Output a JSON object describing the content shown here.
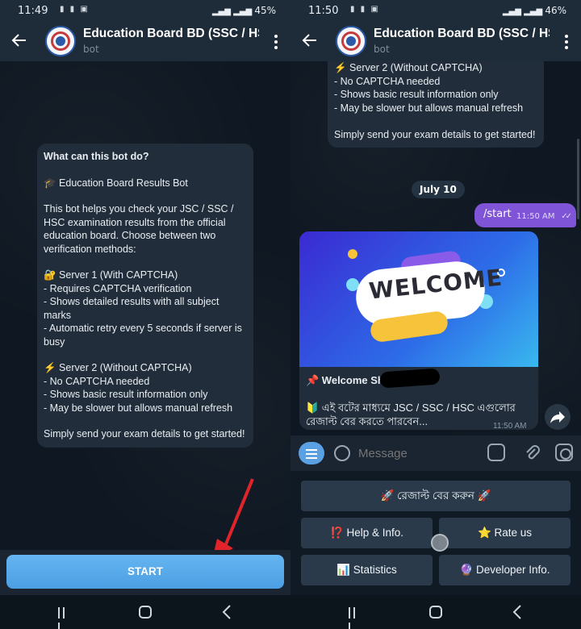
{
  "left": {
    "status": {
      "time": "11:49",
      "battery": "45%"
    },
    "header": {
      "title": "Education Board BD (SSC / HSC)",
      "subtitle": "bot"
    },
    "info": {
      "heading": "What can this bot do?",
      "intro": "🎓 Education Board Results Bot",
      "para1": "This bot helps you check your JSC / SSC / HSC examination results from the official education board. Choose between two verification methods:",
      "server1": "🔐 Server 1 (With CAPTCHA)\n- Requires CAPTCHA verification\n- Shows detailed results with all subject marks\n- Automatic retry every 5 seconds if server is busy",
      "server2": "⚡ Server 2 (Without CAPTCHA)\n- No CAPTCHA needed\n- Shows basic result information only\n- May be slower but allows manual refresh",
      "outro": "Simply send your exam details to get started!"
    },
    "start_label": "START"
  },
  "right": {
    "status": {
      "time": "11:50",
      "battery": "46%"
    },
    "header": {
      "title": "Education Board BD (SSC / HSC)",
      "subtitle": "bot"
    },
    "prev_message": "⚡ Server 2 (Without CAPTCHA)\n- No CAPTCHA needed\n- Shows basic result information only\n- May be slower but allows manual refresh\n\nSimply send your exam details to get started!",
    "date_chip": "July 10",
    "outgoing": {
      "text": "/start",
      "time": "11:50 AM"
    },
    "card": {
      "banner_text": "WELCOME",
      "title": "📌 Welcome Shafi",
      "text": "🔰 এই বটের মাধ্যমে JSC / SSC / HSC এগুলোর রেজাল্ট বের করতে পারবেন...",
      "time": "11:50 AM"
    },
    "input": {
      "placeholder": "Message"
    },
    "keyboard": {
      "row1": "🚀 রেজাল্ট বের করুন 🚀",
      "help": "⁉️ Help & Info.",
      "rate": "⭐ Rate us",
      "stats": "📊 Statistics",
      "dev": "🔮 Developer Info."
    }
  },
  "colors": {
    "accent": "#5aa0e3",
    "outgoing": "#8054d6",
    "bg": "#0e1621",
    "panel": "#212d3a",
    "arrow": "#e0242a"
  }
}
